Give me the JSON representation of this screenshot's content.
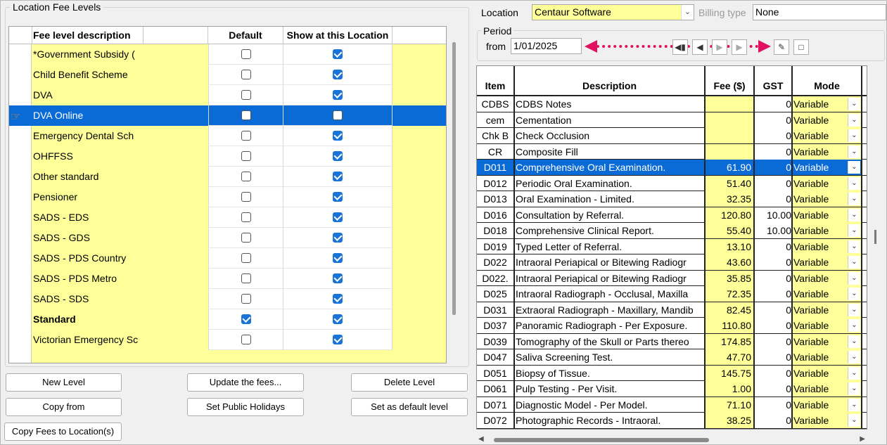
{
  "location_fee_levels": {
    "title": "Location Fee Levels",
    "columns": [
      "Fee level description",
      "Default",
      "Show at this Location"
    ],
    "rows": [
      {
        "label": "*Government Subsidy (",
        "default": false,
        "show": true,
        "bold": false,
        "selected": false
      },
      {
        "label": "Child Benefit Scheme",
        "default": false,
        "show": true,
        "bold": false,
        "selected": false
      },
      {
        "label": "DVA",
        "default": false,
        "show": true,
        "bold": false,
        "selected": false
      },
      {
        "label": "DVA Online",
        "default": false,
        "show": false,
        "bold": false,
        "selected": true
      },
      {
        "label": "Emergency Dental Sch",
        "default": false,
        "show": true,
        "bold": false,
        "selected": false
      },
      {
        "label": "OHFFSS",
        "default": false,
        "show": true,
        "bold": false,
        "selected": false
      },
      {
        "label": "Other standard",
        "default": false,
        "show": true,
        "bold": false,
        "selected": false
      },
      {
        "label": "Pensioner",
        "default": false,
        "show": true,
        "bold": false,
        "selected": false
      },
      {
        "label": "SADS - EDS",
        "default": false,
        "show": true,
        "bold": false,
        "selected": false
      },
      {
        "label": "SADS - GDS",
        "default": false,
        "show": true,
        "bold": false,
        "selected": false
      },
      {
        "label": "SADS - PDS Country",
        "default": false,
        "show": true,
        "bold": false,
        "selected": false
      },
      {
        "label": "SADS - PDS Metro",
        "default": false,
        "show": true,
        "bold": false,
        "selected": false
      },
      {
        "label": "SADS - SDS",
        "default": false,
        "show": true,
        "bold": false,
        "selected": false
      },
      {
        "label": "Standard",
        "default": true,
        "show": true,
        "bold": true,
        "selected": false
      },
      {
        "label": "Victorian Emergency Sc",
        "default": false,
        "show": true,
        "bold": false,
        "selected": false
      }
    ],
    "row_pointer_icon": "hand-pointer-icon"
  },
  "buttons": {
    "new_level": "New Level",
    "update_fees": "Update the fees...",
    "delete_level": "Delete Level",
    "copy_from": "Copy from",
    "set_public_holidays": "Set Public Holidays",
    "set_default_level": "Set as default level",
    "copy_fees_to_location": "Copy Fees to Location(s)"
  },
  "location": {
    "label": "Location",
    "value": "Centaur Software",
    "billing_type_label": "Billing type",
    "billing_type_value": "None"
  },
  "period": {
    "title": "Period",
    "from_label": "from",
    "from_value": "1/01/2025",
    "nav_icons": [
      "first-icon",
      "prev-icon",
      "next-icon",
      "last-icon",
      "new-period-icon",
      "edit-period-icon",
      "blank-page-icon"
    ],
    "arrow_color": "#e0115f"
  },
  "items_grid": {
    "columns": [
      "Item",
      "Description",
      "Fee ($)",
      "GST",
      "Mode"
    ],
    "rows": [
      {
        "item": "CDBS",
        "desc": "CDBS Notes",
        "fee": "",
        "gst": "0",
        "mode": "Variable",
        "selected": false
      },
      {
        "item": "cem",
        "desc": "Cementation",
        "fee": "",
        "gst": "0",
        "mode": "Variable",
        "selected": false
      },
      {
        "item": "Chk B",
        "desc": "Check Occlusion",
        "fee": "",
        "gst": "0",
        "mode": "Variable",
        "selected": false
      },
      {
        "item": "CR",
        "desc": "Composite Fill",
        "fee": "",
        "gst": "0",
        "mode": "Variable",
        "selected": false
      },
      {
        "item": "D011",
        "desc": "Comprehensive Oral Examination.",
        "fee": "61.90",
        "gst": "0",
        "mode": "Variable",
        "selected": true
      },
      {
        "item": "D012",
        "desc": "Periodic Oral Examination.",
        "fee": "51.40",
        "gst": "0",
        "mode": "Variable",
        "selected": false
      },
      {
        "item": "D013",
        "desc": "Oral Examination - Limited.",
        "fee": "32.35",
        "gst": "0",
        "mode": "Variable",
        "selected": false
      },
      {
        "item": "D016",
        "desc": "Consultation by Referral.",
        "fee": "120.80",
        "gst": "10.00",
        "mode": "Variable",
        "selected": false
      },
      {
        "item": "D018",
        "desc": "Comprehensive Clinical Report.",
        "fee": "55.40",
        "gst": "10.00",
        "mode": "Variable",
        "selected": false
      },
      {
        "item": "D019",
        "desc": "Typed Letter of Referral.",
        "fee": "13.10",
        "gst": "0",
        "mode": "Variable",
        "selected": false
      },
      {
        "item": "D022",
        "desc": "Intraoral Periapical or Bitewing Radiogr",
        "fee": "43.60",
        "gst": "0",
        "mode": "Variable",
        "selected": false
      },
      {
        "item": "D022.",
        "desc": "Intraoral Periapical or Bitewing Radiogr",
        "fee": "35.85",
        "gst": "0",
        "mode": "Variable",
        "selected": false
      },
      {
        "item": "D025",
        "desc": "Intraoral Radiograph - Occlusal, Maxilla",
        "fee": "72.35",
        "gst": "0",
        "mode": "Variable",
        "selected": false
      },
      {
        "item": "D031",
        "desc": "Extraoral Radiograph - Maxillary, Mandib",
        "fee": "82.45",
        "gst": "0",
        "mode": "Variable",
        "selected": false
      },
      {
        "item": "D037",
        "desc": "Panoramic Radiograph - Per Exposure.",
        "fee": "110.80",
        "gst": "0",
        "mode": "Variable",
        "selected": false
      },
      {
        "item": "D039",
        "desc": "Tomography of the Skull or Parts thereo",
        "fee": "174.85",
        "gst": "0",
        "mode": "Variable",
        "selected": false
      },
      {
        "item": "D047",
        "desc": "Saliva Screening Test.",
        "fee": "47.70",
        "gst": "0",
        "mode": "Variable",
        "selected": false
      },
      {
        "item": "D051",
        "desc": "Biopsy of Tissue.",
        "fee": "145.75",
        "gst": "0",
        "mode": "Variable",
        "selected": false
      },
      {
        "item": "D061",
        "desc": "Pulp Testing - Per Visit.",
        "fee": "1.00",
        "gst": "0",
        "mode": "Variable",
        "selected": false
      },
      {
        "item": "D071",
        "desc": "Diagnostic Model - Per Model.",
        "fee": "71.10",
        "gst": "0",
        "mode": "Variable",
        "selected": false
      },
      {
        "item": "D072",
        "desc": "Photographic Records - Intraoral.",
        "fee": "38.25",
        "gst": "0",
        "mode": "Variable",
        "selected": false
      }
    ]
  },
  "colors": {
    "selection": "#0a6ad6",
    "editable_yellow": "#ffff99",
    "checkbox_on": "#1a73d6"
  }
}
